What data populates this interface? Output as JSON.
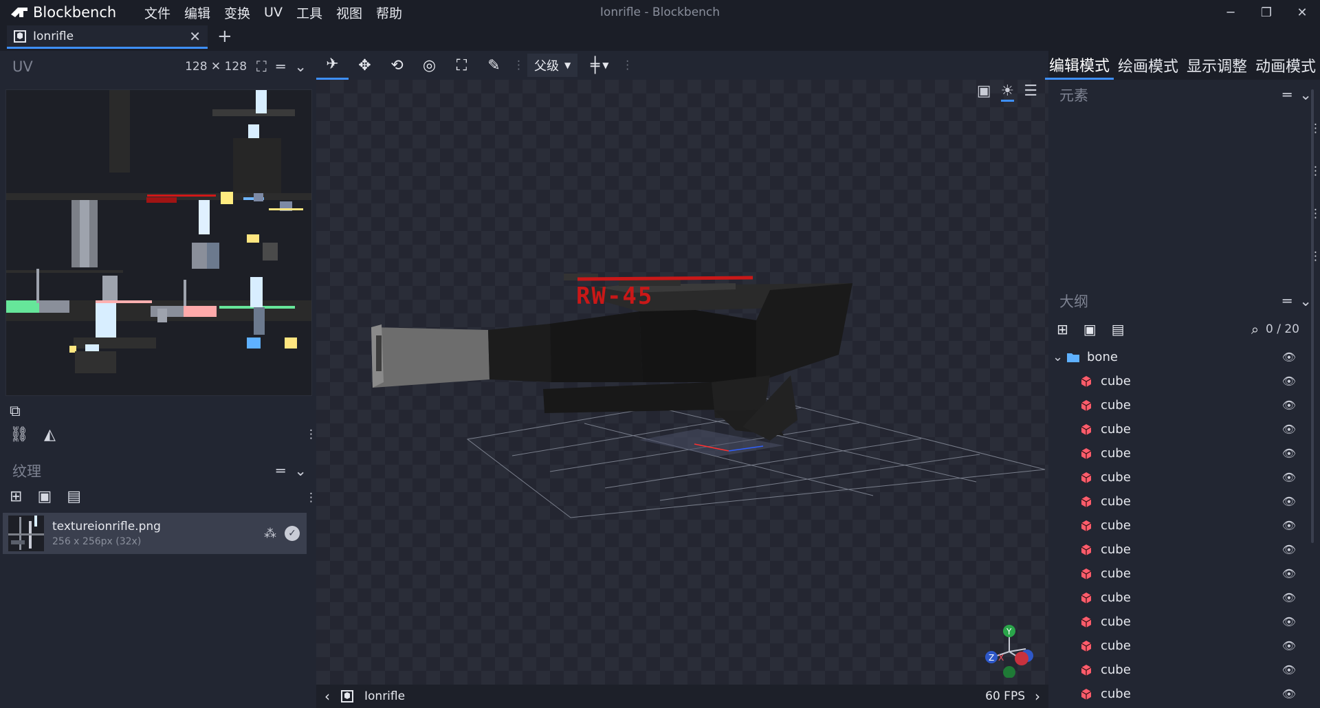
{
  "app": {
    "name": "Blockbench",
    "window_title": "Ionrifle - Blockbench",
    "menu": [
      "文件",
      "编辑",
      "变换",
      "UV",
      "工具",
      "视图",
      "帮助"
    ]
  },
  "tab": {
    "label": "Ionrifle"
  },
  "uv_panel": {
    "title": "UV",
    "size": "128 ✕ 128"
  },
  "texture_panel": {
    "title": "纹理",
    "texture": {
      "name": "textureionrifle.png",
      "meta": "256 x 256px (32x)"
    }
  },
  "toolbar": {
    "pivot_label": "父级"
  },
  "modes": [
    "编辑模式",
    "绘画模式",
    "显示调整",
    "动画模式"
  ],
  "viewport": {
    "model_text": "RW-45",
    "axis_y": "Y",
    "axis_x": "X",
    "axis_z": "Z"
  },
  "statusbar": {
    "model_name": "Ionrifle",
    "fps": "60 FPS"
  },
  "elements_panel": {
    "title": "元素"
  },
  "outliner": {
    "title": "大纲",
    "counter": "0 / 20",
    "group": "bone",
    "items": [
      "cube",
      "cube",
      "cube",
      "cube",
      "cube",
      "cube",
      "cube",
      "cube",
      "cube",
      "cube",
      "cube",
      "cube",
      "cube",
      "cube"
    ]
  },
  "colors": {
    "accent": "#3e90ff",
    "cube_icon": "#ff5c6b",
    "folder_icon": "#5fb1ff",
    "decal_red": "#c91818"
  }
}
